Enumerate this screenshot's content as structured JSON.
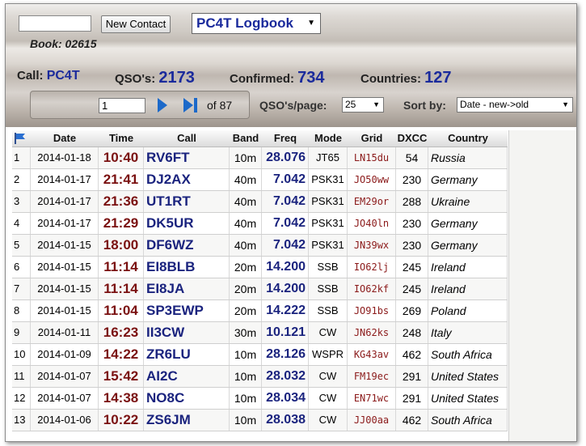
{
  "header": {
    "search_value": "",
    "new_contact_label": "New Contact",
    "logbook_select": "PC4T Logbook",
    "book_label": "Book: 02615"
  },
  "stats": {
    "call_label": "Call:",
    "call_value": "PC4T",
    "qsos_label": "QSO's:",
    "qsos_value": "2173",
    "confirmed_label": "Confirmed:",
    "confirmed_value": "734",
    "countries_label": "Countries:",
    "countries_value": "127"
  },
  "pager": {
    "page": "1",
    "of_label": "of 87",
    "per_page_label": "QSO's/page:",
    "per_page_value": "25",
    "sort_label": "Sort by:",
    "sort_value": "Date - new->old",
    "next_icon": "play-icon",
    "last_icon": "skip-to-end-icon"
  },
  "table": {
    "columns": [
      "Date",
      "Time",
      "Call",
      "Band",
      "Freq",
      "Mode",
      "Grid",
      "DXCC",
      "Country"
    ],
    "flag_icon": "flag-icon",
    "rows": [
      [
        "1",
        "2014-01-18",
        "10:40",
        "RV6FT",
        "10m",
        "28.076",
        "JT65",
        "LN15du",
        "54",
        "Russia"
      ],
      [
        "2",
        "2014-01-17",
        "21:41",
        "DJ2AX",
        "40m",
        "7.042",
        "PSK31",
        "JO50ww",
        "230",
        "Germany"
      ],
      [
        "3",
        "2014-01-17",
        "21:36",
        "UT1RT",
        "40m",
        "7.042",
        "PSK31",
        "EM29or",
        "288",
        "Ukraine"
      ],
      [
        "4",
        "2014-01-17",
        "21:29",
        "DK5UR",
        "40m",
        "7.042",
        "PSK31",
        "JO40ln",
        "230",
        "Germany"
      ],
      [
        "5",
        "2014-01-15",
        "18:00",
        "DF6WZ",
        "40m",
        "7.042",
        "PSK31",
        "JN39wx",
        "230",
        "Germany"
      ],
      [
        "6",
        "2014-01-15",
        "11:14",
        "EI8BLB",
        "20m",
        "14.200",
        "SSB",
        "IO62lj",
        "245",
        "Ireland"
      ],
      [
        "7",
        "2014-01-15",
        "11:14",
        "EI8JA",
        "20m",
        "14.200",
        "SSB",
        "IO62kf",
        "245",
        "Ireland"
      ],
      [
        "8",
        "2014-01-15",
        "11:04",
        "SP3EWP",
        "20m",
        "14.222",
        "SSB",
        "JO91bs",
        "269",
        "Poland"
      ],
      [
        "9",
        "2014-01-11",
        "16:23",
        "II3CW",
        "30m",
        "10.121",
        "CW",
        "JN62ks",
        "248",
        "Italy"
      ],
      [
        "10",
        "2014-01-09",
        "14:22",
        "ZR6LU",
        "10m",
        "28.126",
        "WSPR",
        "KG43av",
        "462",
        "South Africa"
      ],
      [
        "11",
        "2014-01-07",
        "15:42",
        "AI2C",
        "10m",
        "28.032",
        "CW",
        "FM19ec",
        "291",
        "United States"
      ],
      [
        "12",
        "2014-01-07",
        "14:38",
        "NO8C",
        "10m",
        "28.034",
        "CW",
        "EN71wc",
        "291",
        "United States"
      ],
      [
        "13",
        "2014-01-06",
        "10:22",
        "ZS6JM",
        "10m",
        "28.038",
        "CW",
        "JJ00aa",
        "462",
        "South Africa"
      ]
    ]
  }
}
